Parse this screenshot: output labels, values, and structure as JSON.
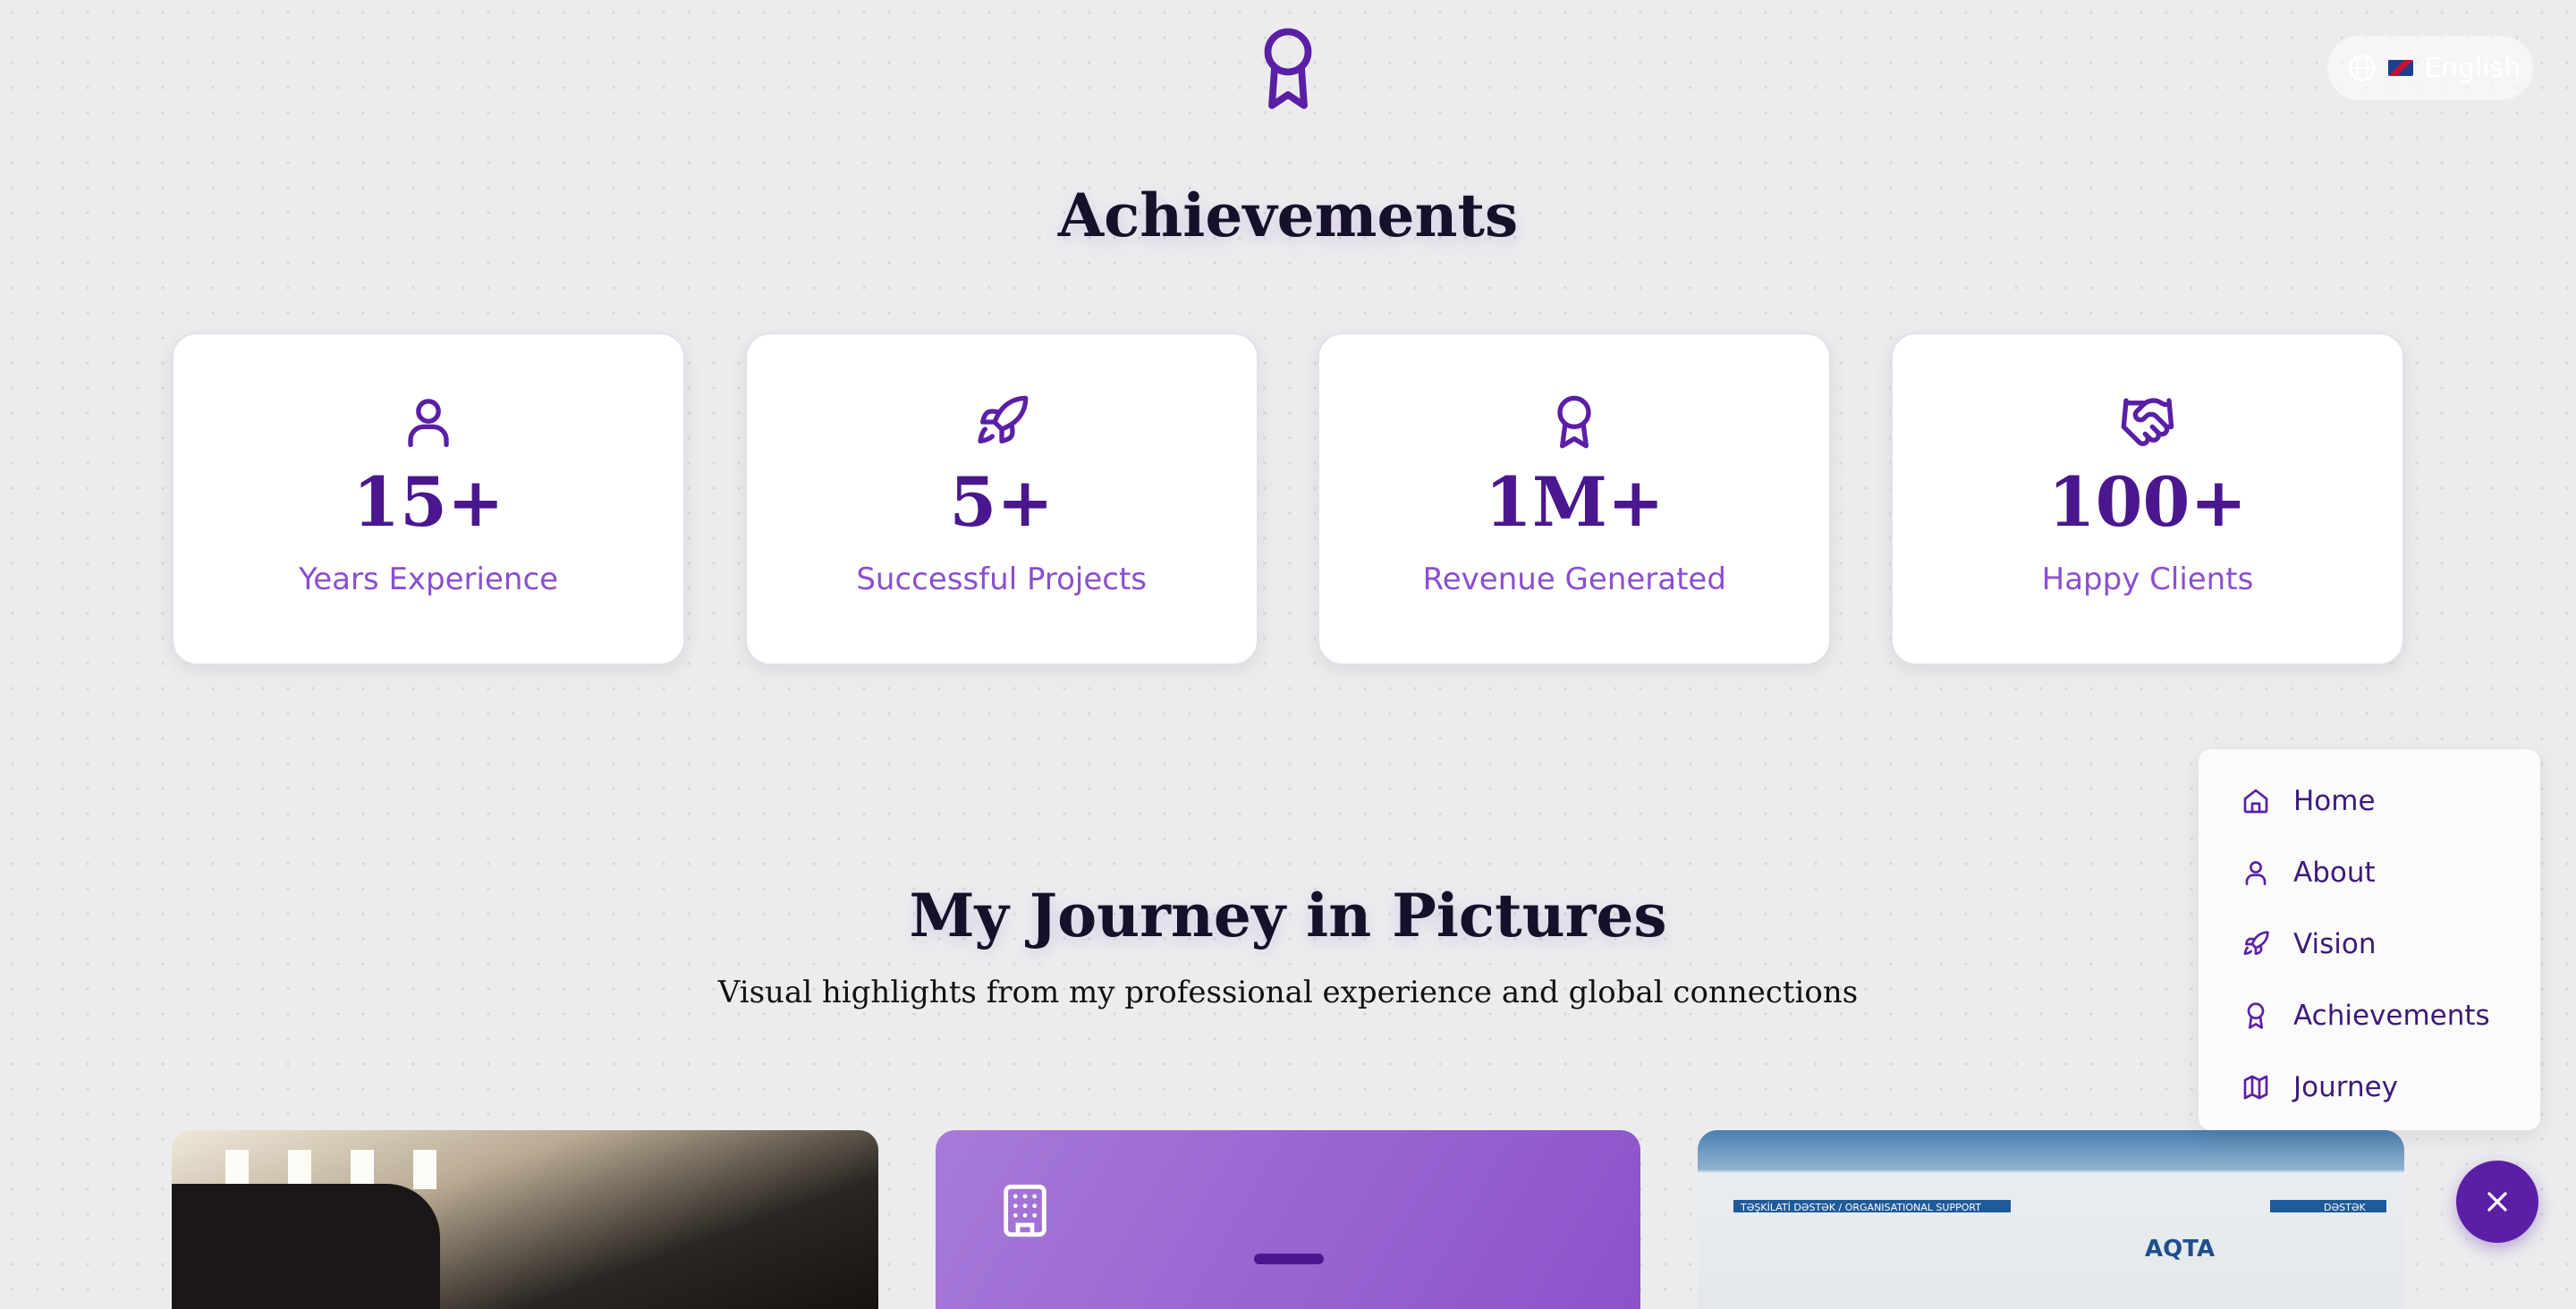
{
  "language": {
    "label": "English"
  },
  "achievements": {
    "title": "Achievements",
    "stats": [
      {
        "icon": "user-icon",
        "value": "15+",
        "label": "Years Experience"
      },
      {
        "icon": "rocket-icon",
        "value": "5+",
        "label": "Successful Projects"
      },
      {
        "icon": "award-icon",
        "value": "1M+",
        "label": "Revenue Generated"
      },
      {
        "icon": "handshake-icon",
        "value": "100+",
        "label": "Happy Clients"
      }
    ]
  },
  "journey": {
    "title": "My Journey in Pictures",
    "subtitle": "Visual highlights from my professional experience and global connections",
    "gallery_text": {
      "banner_left": "TƏŞKİLATİ DƏSTƏK / ORGANISATIONAL SUPPORT",
      "banner_right": "DƏSTƏK",
      "logo": "AQTA"
    }
  },
  "nav": {
    "items": [
      {
        "icon": "home-icon",
        "label": "Home"
      },
      {
        "icon": "user-icon",
        "label": "About"
      },
      {
        "icon": "rocket-icon",
        "label": "Vision"
      },
      {
        "icon": "award-icon",
        "label": "Achievements"
      },
      {
        "icon": "map-icon",
        "label": "Journey"
      }
    ]
  },
  "colors": {
    "accent": "#5b1fa6",
    "stat_value": "#4a178f",
    "stat_label": "#8a4fd0",
    "background": "#ececee"
  }
}
